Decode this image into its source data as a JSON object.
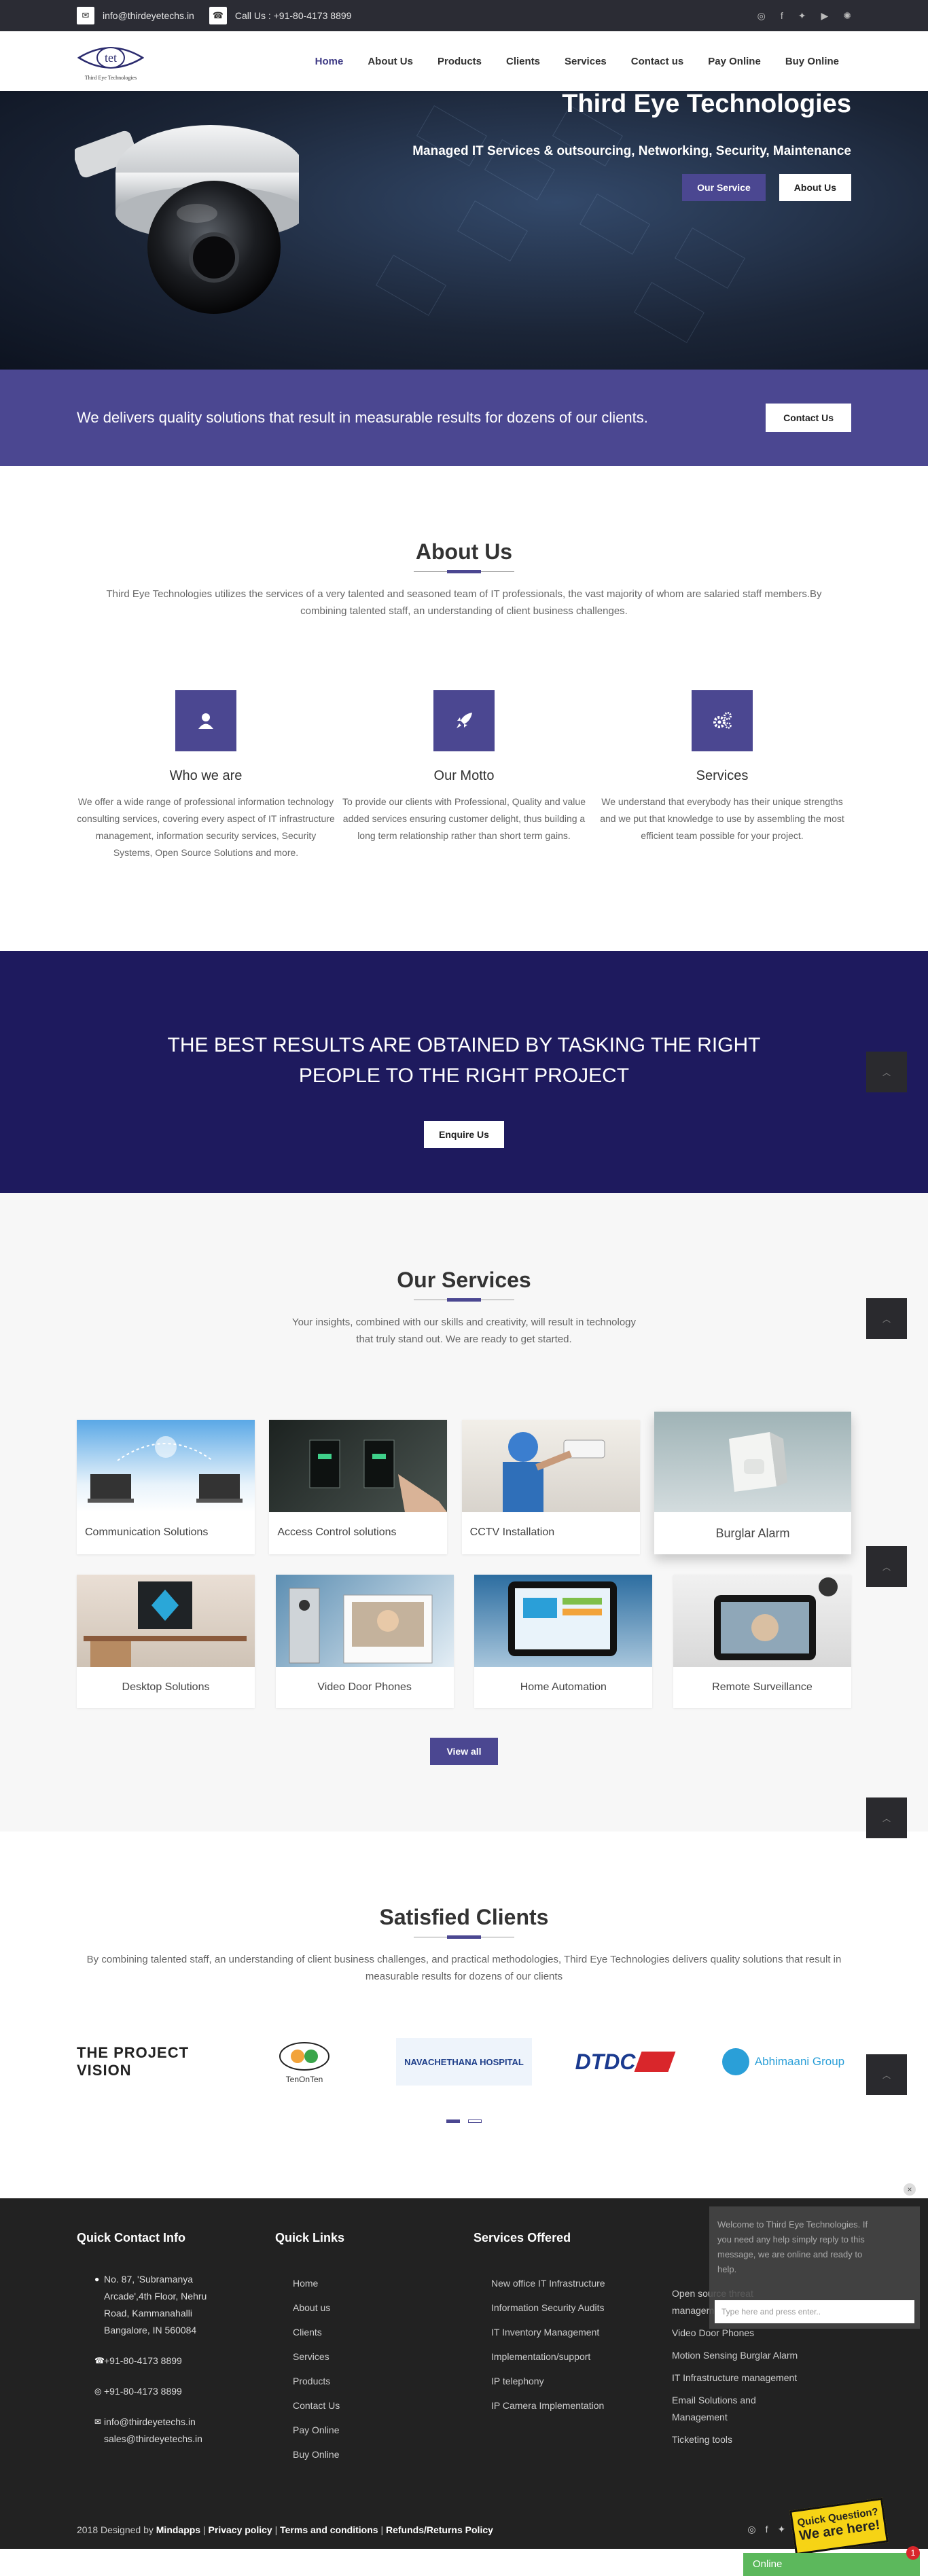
{
  "topbar": {
    "email": "info@thirdeyetechs.in",
    "call": "Call Us : +91-80-4173 8899"
  },
  "logo": {
    "mark": "tet",
    "tagline": "Third Eye Technologies"
  },
  "nav": [
    "Home",
    "About Us",
    "Products",
    "Clients",
    "Services",
    "Contact us",
    "Pay Online",
    "Buy Online"
  ],
  "hero": {
    "title": "Third Eye Technologies",
    "subtitle": "Managed IT Services & outsourcing, Networking, Security, Maintenance",
    "btn_service": "Our Service",
    "btn_about": "About Us"
  },
  "strip": {
    "text": "We delivers quality solutions that result in measurable results for dozens of our clients.",
    "btn": "Contact Us"
  },
  "about": {
    "title": "About Us",
    "desc": "Third Eye Technologies utilizes the services of a very talented and seasoned team of IT professionals, the vast majority of whom are salaried staff members.By combining talented staff, an understanding of client business challenges.",
    "features": [
      {
        "title": "Who we are",
        "text": "We offer a wide range of professional information technology consulting services, covering every aspect of IT infrastructure management, information security services, Security Systems, Open Source Solutions and more."
      },
      {
        "title": "Our Motto",
        "text": "To provide our clients with Professional, Quality and value added services ensuring customer delight, thus building a long term relationship rather than short term gains."
      },
      {
        "title": "Services",
        "text": "We understand that everybody has their unique strengths and we put that knowledge to use by assembling the most efficient team possible for your project."
      }
    ]
  },
  "quote": {
    "line1": "THE BEST RESULTS ARE OBTAINED BY TASKING THE RIGHT",
    "line2": "PEOPLE TO THE RIGHT PROJECT",
    "btn": "Enquire Us"
  },
  "services": {
    "title": "Our Services",
    "desc1": "Your insights, combined with our skills and creativity, will result in technology",
    "desc2": "that truly stand out. We are ready to get started.",
    "items": [
      "Communication Solutions",
      "Access Control solutions",
      "CCTV Installation",
      "Burglar Alarm",
      "Desktop Solutions",
      "Video Door Phones",
      "Home Automation",
      "Remote Surveillance"
    ],
    "view_all": "View all"
  },
  "clients": {
    "title": "Satisfied Clients",
    "desc": "By combining talented staff, an understanding of client business challenges, and practical methodologies, Third Eye Technologies delivers quality solutions that result in measurable results for dozens of our clients",
    "logos": [
      "THE PROJECT VISION",
      "TenOnTen",
      "NAVACHETHANA HOSPITAL",
      "DTDC",
      "Abhimaani Group"
    ]
  },
  "footer": {
    "contact_title": "Quick Contact Info",
    "address": "No. 87, 'Subramanya Arcade',4th Floor, Nehru Road, Kammanahalli Bangalore, IN 560084",
    "phone": "+91-80-4173 8899",
    "whatsapp": "+91-80-4173 8899",
    "email1": "info@thirdeyetechs.in",
    "email2": "sales@thirdeyetechs.in",
    "links_title": "Quick Links",
    "links": [
      "Home",
      "About us",
      "Clients",
      "Services",
      "Products",
      "Contact Us",
      "Pay Online",
      "Buy Online"
    ],
    "offered_title": "Services Offered",
    "offered": [
      "New office IT Infrastructure",
      "Information Security Audits",
      "IT Inventory Management",
      "Implementation/support",
      "IP telephony",
      "IP Camera Implementation"
    ],
    "col4": [
      "Open source threat management solutions",
      "Video Door Phones",
      "Motion Sensing Burglar Alarm",
      "IT Infrastructure management",
      "Email Solutions and Management",
      "Ticketing tools"
    ],
    "copyright": "2018 Designed by",
    "designer": "Mindapps",
    "privacy": "Privacy policy",
    "terms": "Terms and conditions",
    "refunds": "Refunds/Returns Policy"
  },
  "chat": {
    "message": "Welcome to Third Eye Technologies. If you need any help simply reply to this message, we are online and ready to help.",
    "placeholder": "Type here and press enter..",
    "status": "Online",
    "badge": "1",
    "quick1": "Quick Question?",
    "quick2": "We are here!"
  },
  "colors": {
    "accent": "#4b4791",
    "dark_band": "#1e1a5e",
    "footer": "#222222",
    "online": "#5cb85c"
  }
}
